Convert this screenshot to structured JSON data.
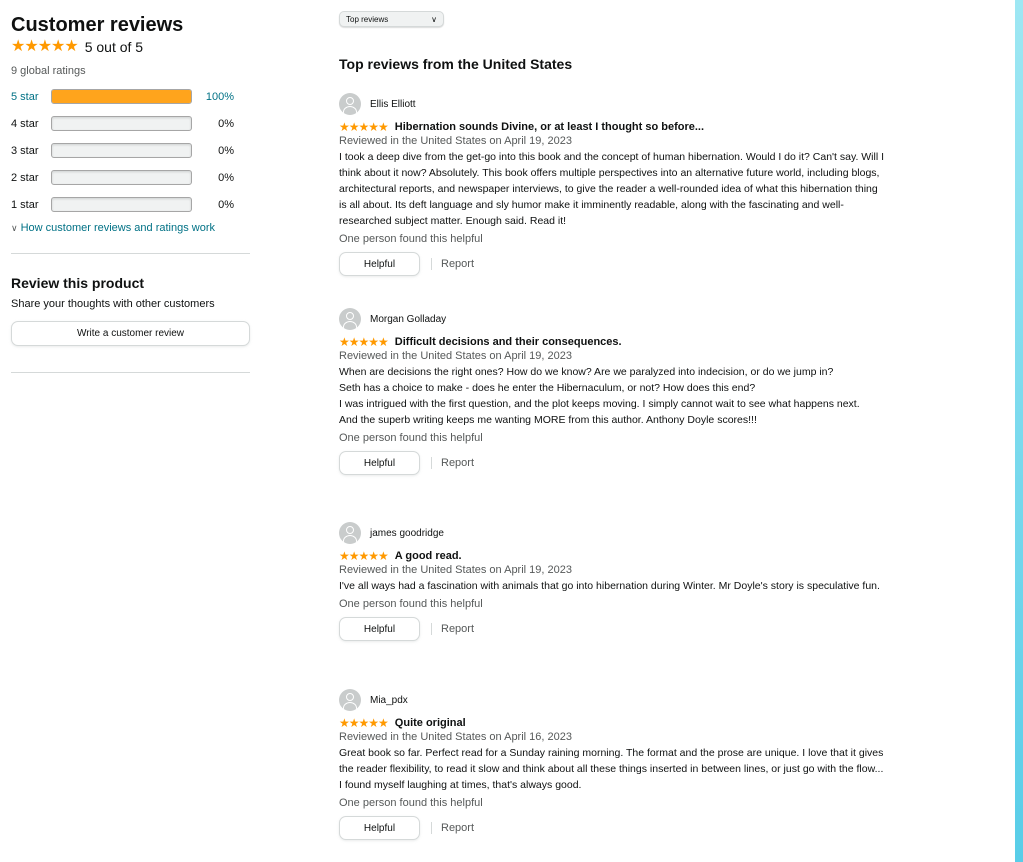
{
  "summary": {
    "title": "Customer reviews",
    "stars": "★★★★★",
    "rating_text": "5 out of 5",
    "global_ratings": "9 global ratings",
    "histogram": [
      {
        "label": "5 star",
        "percent_text": "100%",
        "percent": 100
      },
      {
        "label": "4 star",
        "percent_text": "0%",
        "percent": 0
      },
      {
        "label": "3 star",
        "percent_text": "0%",
        "percent": 0
      },
      {
        "label": "2 star",
        "percent_text": "0%",
        "percent": 0
      },
      {
        "label": "1 star",
        "percent_text": "0%",
        "percent": 0
      }
    ],
    "how_link": "How customer reviews and ratings work",
    "how_icon": "chevron-down-icon"
  },
  "review_product": {
    "title": "Review this product",
    "subtitle": "Share your thoughts with other customers",
    "button": "Write a customer review"
  },
  "sort": {
    "selected": "Top reviews"
  },
  "reviews_heading": "Top reviews from the United States",
  "reviews": [
    {
      "name": "Ellis Elliott",
      "stars": "★★★★★",
      "title": "Hibernation sounds Divine, or at least I thought so before...",
      "date": "Reviewed in the United States on April 19, 2023",
      "body": [
        "I took a deep dive from the get-go into this book and the concept of human hibernation. Would I do it? Can't say. Will I think about it now? Absolutely. This book offers multiple perspectives into an alternative future world, including blogs, architectural reports, and newspaper interviews, to give the reader a well-rounded idea of what this hibernation thing is all about. Its deft language and sly humor make it imminently readable, along with the fascinating and well-researched subject matter. Enough said. Read it!"
      ],
      "helpful_count": "One person found this helpful",
      "helpful_label": "Helpful",
      "report_label": "Report"
    },
    {
      "name": "Morgan Golladay",
      "stars": "★★★★★",
      "title": "Difficult decisions and their consequences.",
      "date": "Reviewed in the United States on April 19, 2023",
      "body": [
        "When are decisions the right ones? How do we know? Are we paralyzed into indecision, or do we jump in?",
        "Seth has a choice to make - does he enter the Hibernaculum, or not? How does this end?",
        "I was intrigued with the first question, and the plot keeps moving. I simply cannot wait to see what happens next.",
        "And the superb writing keeps me wanting MORE from this author. Anthony Doyle scores!!!"
      ],
      "helpful_count": "One person found this helpful",
      "helpful_label": "Helpful",
      "report_label": "Report"
    },
    {
      "name": "james goodridge",
      "stars": "★★★★★",
      "title": "A good read.",
      "date": "Reviewed in the United States on April 19, 2023",
      "body": [
        "I've all ways had a fascination with animals that go into hibernation during Winter. Mr Doyle's story is speculative fun."
      ],
      "helpful_count": "One person found this helpful",
      "helpful_label": "Helpful",
      "report_label": "Report"
    },
    {
      "name": "Mia_pdx",
      "stars": "★★★★★",
      "title": "Quite original",
      "date": "Reviewed in the United States on April 16, 2023",
      "body": [
        "Great book so far. Perfect read for a Sunday raining morning. The format and the prose are unique. I love that it gives the reader flexibility, to read it slow and think about all these things inserted in between lines, or just go with the flow... I found myself laughing at times, that's always good."
      ],
      "helpful_count": "One person found this helpful",
      "helpful_label": "Helpful",
      "report_label": "Report"
    }
  ],
  "colors": {
    "star": "#ff9900",
    "bar_fill": "#ffa41c",
    "link": "#007185"
  }
}
